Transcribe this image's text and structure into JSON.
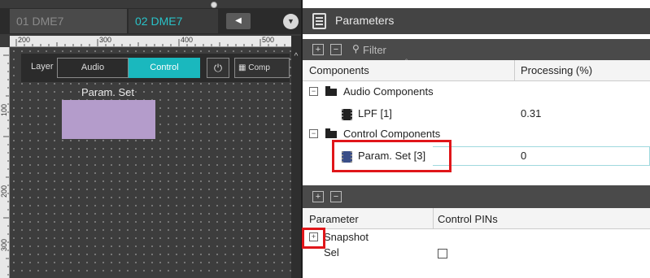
{
  "sheet_tabs": [
    {
      "label": "01 DME7",
      "active": false
    },
    {
      "label": "02 DME7",
      "active": true
    }
  ],
  "ruler": {
    "top_labels": [
      "200",
      "300",
      "400",
      "500"
    ],
    "left_labels": [
      "100",
      "200",
      "300"
    ]
  },
  "layer_bar": {
    "label": "Layer",
    "audio_label": "Audio",
    "control_label": "Control",
    "control_active_color": "#1ab8be",
    "components_button_label": "Comp",
    "plug_icon": "plug-icon",
    "components_icon": "grid-icon"
  },
  "canvas": {
    "block_label": "Param. Set",
    "block_color": "#b49ccb"
  },
  "parameters_panel": {
    "title": "Parameters",
    "filter_placeholder": "Filter",
    "components_table": {
      "columns": [
        "Components",
        "Processing (%)"
      ],
      "rows": [
        {
          "type": "folder",
          "label": "Audio Components",
          "expanded": true
        },
        {
          "type": "component",
          "label": "LPF [1]",
          "value": "0.31"
        },
        {
          "type": "folder",
          "label": "Control Components",
          "expanded": true
        },
        {
          "type": "component",
          "label": "Param. Set [3]",
          "value": "0",
          "selected": true,
          "highlighted": true
        }
      ]
    },
    "parameter_table": {
      "columns": [
        "Parameter",
        "Control PINs"
      ],
      "rows": [
        {
          "label": "Snapshot",
          "expandable": true,
          "highlighted": true
        },
        {
          "label": "Sel",
          "checked": false
        }
      ]
    }
  },
  "colors": {
    "accent_teal": "#29c2c8",
    "highlight_red": "#e0161a",
    "chip_selected": "#3a4e88"
  }
}
